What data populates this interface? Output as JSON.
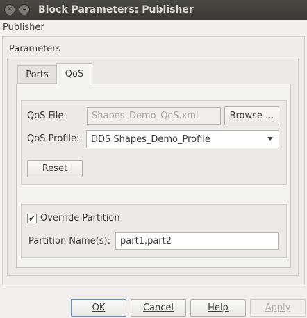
{
  "window": {
    "title": "Block Parameters: Publisher",
    "close_glyph": "×",
    "minimize_glyph": "–"
  },
  "block_name": "Publisher",
  "group_title": "Parameters",
  "tabs": [
    {
      "label": "Ports",
      "active": false
    },
    {
      "label": "QoS",
      "active": true
    }
  ],
  "qos": {
    "file_label": "QoS File:",
    "file_value": "Shapes_Demo_QoS.xml",
    "browse_label": "Browse ...",
    "profile_label": "QoS Profile:",
    "profile_value": "DDS Shapes_Demo_Profile",
    "reset_label": "Reset"
  },
  "partition": {
    "override_label": "Override Partition",
    "override_checked": true,
    "check_glyph": "✔",
    "names_label": "Partition Name(s):",
    "names_value": "part1,part2"
  },
  "buttons": {
    "ok_label": "OK",
    "cancel_label": "Cancel",
    "help_label": "Help",
    "apply_label": "Apply"
  },
  "colors": {
    "titlebar": "#3c3b37",
    "window_bg": "#f1f0ee",
    "default_border": "#6e8db1"
  }
}
